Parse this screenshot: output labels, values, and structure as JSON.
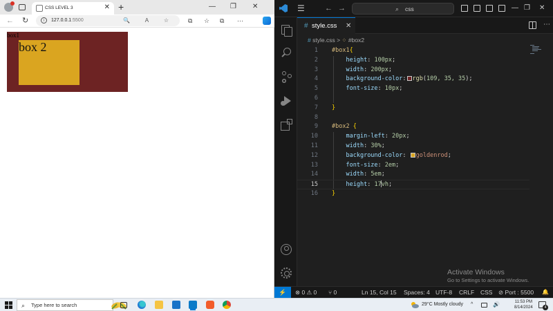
{
  "browser": {
    "tab_title": "CSS LEVEL 3",
    "tab_close": "✕",
    "new_tab": "+",
    "window_minimize": "—",
    "window_restore": "❐",
    "window_close": "✕",
    "back": "←",
    "refresh": "↻",
    "url_host": "127.0.0.1",
    "url_port": ":5500",
    "address_icons": "🔍 A ☆",
    "toolbar_icons": [
      "⧉",
      "☆",
      "⧉",
      "⋯"
    ],
    "page": {
      "box1_label": "box1",
      "box2_label": "box 2"
    }
  },
  "vscode": {
    "menu_icon": "☰",
    "nav_back": "←",
    "nav_forward": "→",
    "search_icon": "⌕",
    "search_text": "css",
    "win_minimize": "—",
    "win_restore": "❐",
    "win_close": "✕",
    "tab": {
      "icon": "#",
      "name": "style.css",
      "close": "✕"
    },
    "more_actions": "⋯",
    "breadcrumb": {
      "icon": "#",
      "file": "style.css",
      "sep": ">",
      "symbol_icon": "⁘",
      "symbol": "#box2"
    },
    "code_lines": [
      {
        "n": "1"
      },
      {
        "n": "2"
      },
      {
        "n": "3"
      },
      {
        "n": "4"
      },
      {
        "n": "5"
      },
      {
        "n": "6"
      },
      {
        "n": "7"
      },
      {
        "n": "8"
      },
      {
        "n": "9"
      },
      {
        "n": "10"
      },
      {
        "n": "11"
      },
      {
        "n": "12"
      },
      {
        "n": "13"
      },
      {
        "n": "14"
      },
      {
        "n": "15"
      },
      {
        "n": "16"
      }
    ],
    "code": {
      "l1_sel": "#box1",
      "l1_brace": "{",
      "l2_prop": "height",
      "l2_val": "100px",
      "l3_prop": "width",
      "l3_val": "200px",
      "l4_prop": "background-color",
      "l4_fn": "rgb",
      "l4_args": "109, 35, 35",
      "l5_prop": "font-size",
      "l5_val": "10px",
      "l7_brace": "}",
      "l9_sel": "#box2",
      "l9_brace": "{",
      "l10_prop": "margin-left",
      "l10_val": "20px",
      "l11_prop": "width",
      "l11_val": "30%",
      "l12_prop": "background-color",
      "l12_val": "goldenrod",
      "l13_prop": "font-size",
      "l13_val": "2em",
      "l14_prop": "width",
      "l14_val": "5em",
      "l15_prop": "height",
      "l15_val_a": "17",
      "l15_val_b": "vh",
      "l16_brace": "}"
    },
    "colors": {
      "box1": "#6d2323",
      "box2": "#daa520",
      "accent": "#0078d4"
    },
    "watermark": {
      "title": "Activate Windows",
      "subtitle": "Go to Settings to activate Windows."
    },
    "status": {
      "remote": "⚡",
      "problems": "⊗ 0 ⚠ 0",
      "ports": "⑂ 0",
      "position": "Ln 15, Col 15",
      "spaces": "Spaces: 4",
      "encoding": "UTF-8",
      "eol": "CRLF",
      "language": "CSS",
      "live_server": "⊘ Port : 5500",
      "bell": "🔔"
    }
  },
  "taskbar": {
    "search_icon": "⌕",
    "search_placeholder": "Type here to search",
    "weather": "29°C  Mostly cloudy",
    "tray": "^",
    "time": "11:53 PM",
    "date": "8/14/2024",
    "notifications": "4"
  }
}
